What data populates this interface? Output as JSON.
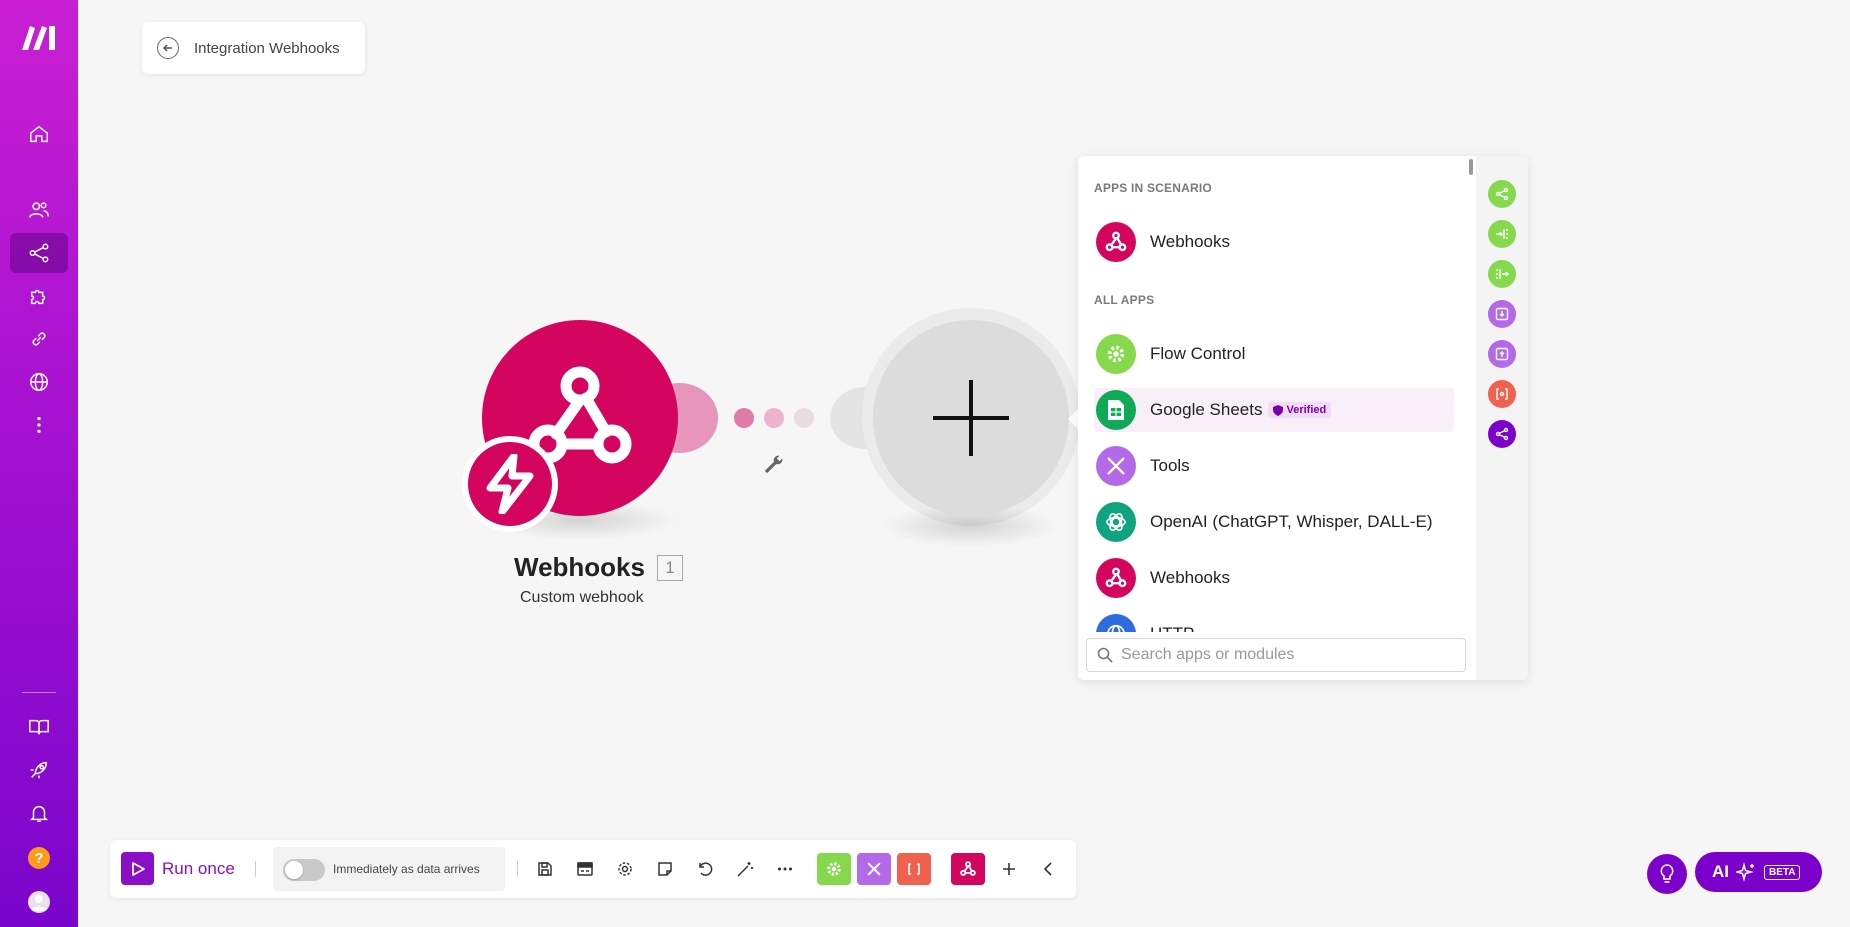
{
  "breadcrumb": {
    "label": "Integration Webhooks"
  },
  "module": {
    "title": "Webhooks",
    "badge": "1",
    "subtitle": "Custom webhook",
    "color": "#d4055e"
  },
  "panel": {
    "section_scenario": "APPS IN SCENARIO",
    "section_all": "ALL APPS",
    "scenario_apps": [
      {
        "name": "Webhooks",
        "icon": "webhooks-icon",
        "color": "#d4055e"
      }
    ],
    "all_apps": [
      {
        "name": "Flow Control",
        "icon": "gear-icon",
        "color": "#86d94d"
      },
      {
        "name": "Google Sheets",
        "icon": "sheets-icon",
        "color": "#0fa958",
        "badge": "Verified"
      },
      {
        "name": "Tools",
        "icon": "tools-icon",
        "color": "#b46ae8"
      },
      {
        "name": "OpenAI (ChatGPT, Whisper, DALL-E)",
        "icon": "openai-icon",
        "color": "#10a37f"
      },
      {
        "name": "Webhooks",
        "icon": "webhooks-icon",
        "color": "#d4055e"
      },
      {
        "name": "HTTP",
        "icon": "globe-icon",
        "color": "#2d6be0"
      }
    ],
    "search_placeholder": "Search apps or modules"
  },
  "toolbar": {
    "run_label": "Run once",
    "schedule_label": "Immediately as data arrives",
    "accent": "#8a10c8"
  },
  "ai": {
    "label": "AI",
    "badge": "BETA"
  }
}
